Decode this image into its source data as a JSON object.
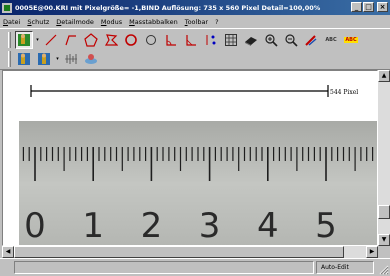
{
  "window": {
    "title": "0005E@00.KRI mit Pixelgröße= -1,BIND    Auflösung: 735 x 560 Pixel    Detail=100,00%"
  },
  "menu": [
    "Datei",
    "Schutz",
    "Detailmode",
    "Modus",
    "Masstabbalken",
    "Toolbar",
    "?"
  ],
  "toolbar": {
    "row1": [
      {
        "name": "pointer-tool-icon",
        "selected": true
      },
      {
        "name": "line-tool-icon"
      },
      {
        "name": "polyline-tool-icon"
      },
      {
        "name": "polygon-tool-icon"
      },
      {
        "name": "freehand-polygon-tool-icon"
      },
      {
        "name": "circle-tool-icon"
      },
      {
        "name": "ellipse-tool-icon"
      },
      {
        "name": "angle-tool-icon"
      },
      {
        "name": "angle-variant-tool-icon"
      },
      {
        "name": "grid-tool-icon"
      },
      {
        "name": "eraser-tool-icon"
      },
      {
        "name": "zoom-in-icon"
      },
      {
        "name": "zoom-out-icon"
      },
      {
        "name": "pen-tool-icon"
      },
      {
        "name": "text-tool-icon",
        "label": "ABC"
      },
      {
        "name": "highlight-text-tool-icon",
        "label": "ABC"
      }
    ],
    "row2": [
      {
        "name": "scale-person-icon"
      },
      {
        "name": "scale-person-variant-icon"
      },
      {
        "name": "measure-bars-icon"
      },
      {
        "name": "calibrate-icon"
      }
    ]
  },
  "canvas": {
    "scale_label": "544 Pixel",
    "ruler_numbers": [
      "0",
      "1",
      "2",
      "3",
      "4",
      "5"
    ]
  },
  "status": {
    "main": "",
    "mode": "Auto-Edit"
  },
  "colors": {
    "titlebar_start": "#0a246a",
    "titlebar_end": "#3a6ea5",
    "window_bg": "#c0c0c0"
  }
}
